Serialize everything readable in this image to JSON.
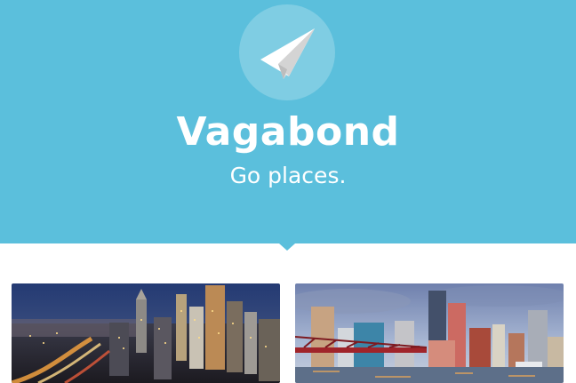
{
  "brand": {
    "logo_icon": "paper-plane-icon",
    "name": "Vagabond",
    "tagline": "Go places."
  },
  "colors": {
    "hero_background": "#5bbfdc",
    "logo_circle": "#86d1e8",
    "text": "#ffffff"
  },
  "cards": [
    {
      "image": "atlanta-night-skyline-photo"
    },
    {
      "image": "boston-waterfront-skyline-photo"
    }
  ]
}
